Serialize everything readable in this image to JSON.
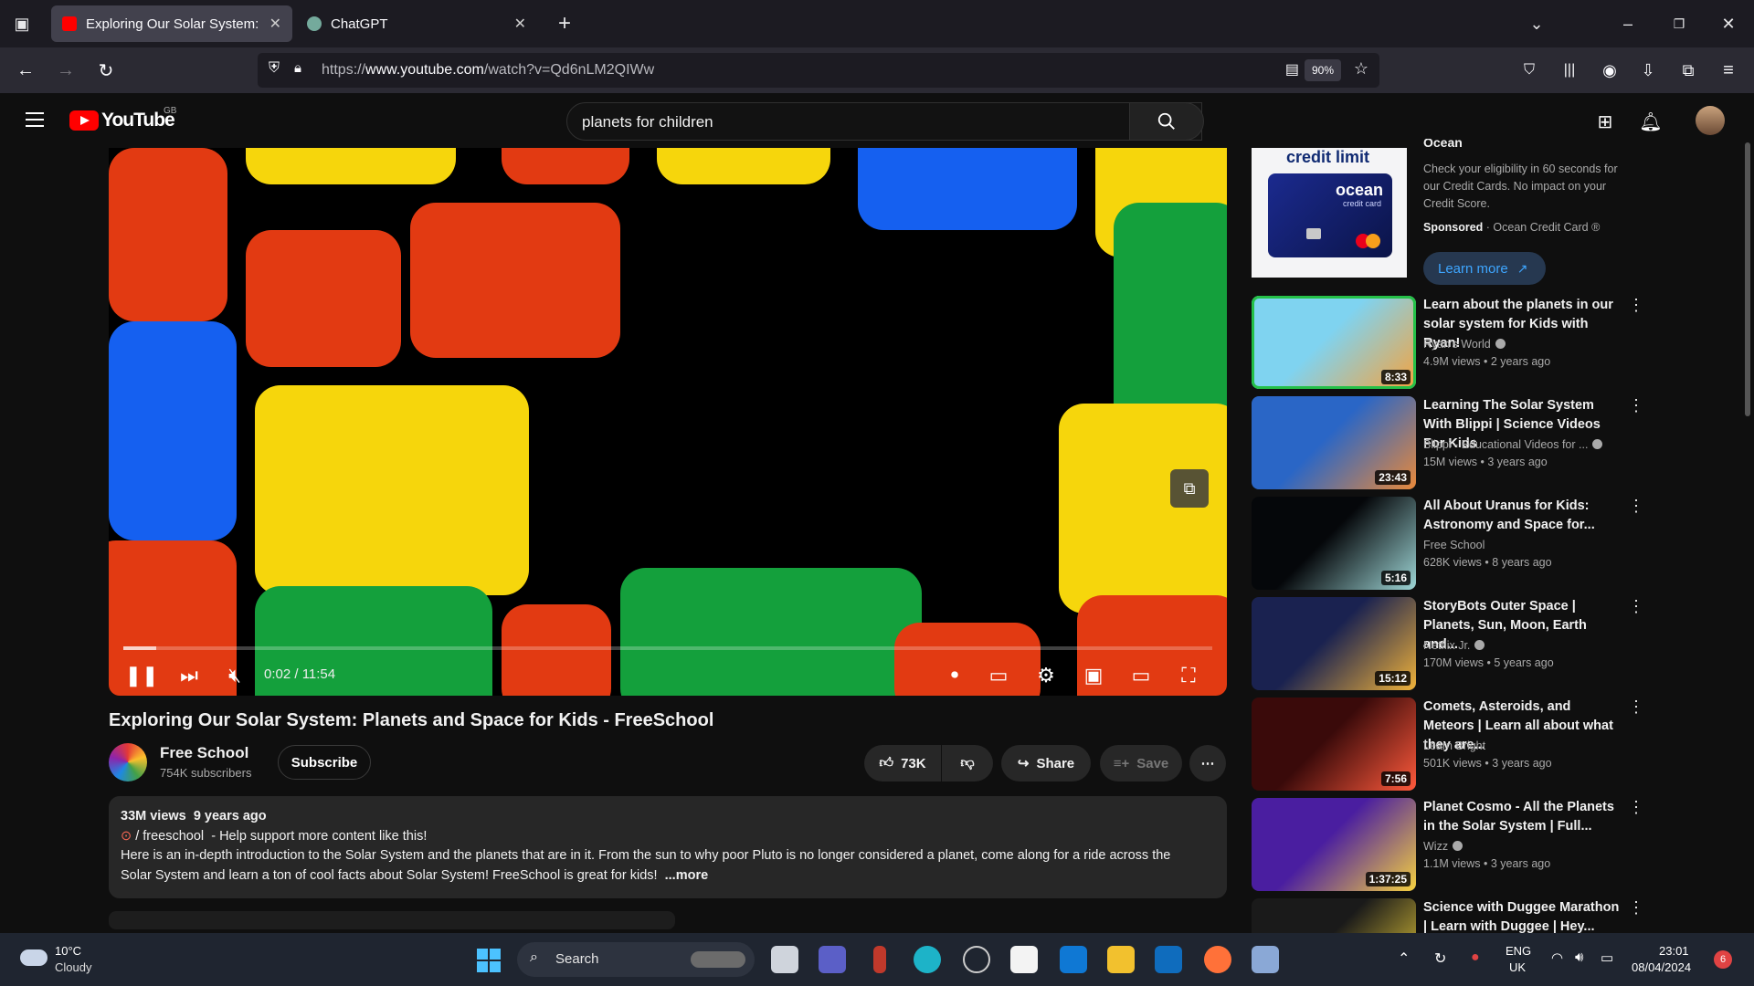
{
  "browser": {
    "tabs": [
      {
        "title": "Exploring Our Solar System: Pla",
        "active": true
      },
      {
        "title": "ChatGPT",
        "active": false
      }
    ],
    "url_prefix": "https://",
    "url_host": "www.youtube.com",
    "url_path": "/watch?v=Qd6nLM2QIWw",
    "zoom": "90%"
  },
  "youtube": {
    "logo_text": "YouTube",
    "country": "GB",
    "search_query": "planets for children"
  },
  "player": {
    "time": "0:02 / 11:54",
    "progress": 0.003
  },
  "video": {
    "title": "Exploring Our Solar System: Planets and Space for Kids - FreeSchool",
    "channel": "Free School",
    "subscribers": "754K subscribers",
    "subscribe_label": "Subscribe",
    "likes": "73K",
    "share_label": "Share",
    "save_label": "Save",
    "views": "33M views",
    "age": "9 years ago",
    "desc_line1_tag": "/ freeschool",
    "desc_line1_rest": "- Help support more content like this!",
    "desc_line2": "Here is an in-depth introduction to the Solar System and the planets that are in it. From the sun to why poor Pluto is no longer considered a planet, come along for a ride across the",
    "desc_line3": "Solar System and learn a ton of cool facts about Solar System! FreeSchool is great for kids!",
    "more_label": "...more"
  },
  "ad": {
    "card_title": "credit limit",
    "card_brand": "ocean",
    "card_sub": "credit card",
    "heading_fragment": "Ocean",
    "text": "Check your eligibility in 60 seconds for our Credit Cards. No impact on your Credit Score.",
    "sponsored": "Sponsored",
    "advertiser": "· Ocean Credit Card ®",
    "cta": "Learn more"
  },
  "recommendations": [
    {
      "title": "Learn about the planets in our solar system for Kids with Ryan!",
      "channel": "Ryan's World",
      "verified": true,
      "views": "4.9M views",
      "age": "2 years ago",
      "duration": "8:33",
      "colors": [
        "#7fd3f0",
        "#f6a23c"
      ]
    },
    {
      "title": "Learning The Solar System With Blippi | Science Videos For Kids",
      "channel": "Blippi - Educational Videos for ...",
      "verified": true,
      "views": "15M views",
      "age": "3 years ago",
      "duration": "23:43",
      "colors": [
        "#2a66c6",
        "#e9893a"
      ]
    },
    {
      "title": "All About Uranus for Kids: Astronomy and Space for...",
      "channel": "Free School",
      "verified": false,
      "views": "628K views",
      "age": "8 years ago",
      "duration": "5:16",
      "colors": [
        "#05070a",
        "#9ed6d6"
      ]
    },
    {
      "title": "StoryBots Outer Space | Planets, Sun, Moon, Earth and...",
      "channel": "Netflix Jr.",
      "verified": true,
      "views": "170M views",
      "age": "5 years ago",
      "duration": "15:12",
      "colors": [
        "#1a2250",
        "#f0b23a"
      ]
    },
    {
      "title": "Comets, Asteroids, and Meteors | Learn all about what they are...",
      "channel": "Learn Bright",
      "verified": false,
      "views": "501K views",
      "age": "3 years ago",
      "duration": "7:56",
      "colors": [
        "#3a0a0a",
        "#ff5a3c"
      ]
    },
    {
      "title": "Planet Cosmo - All the Planets in the Solar System | Full...",
      "channel": "Wizz",
      "verified": true,
      "views": "1.1M views",
      "age": "3 years ago",
      "duration": "1:37:25",
      "colors": [
        "#4a1ea0",
        "#f6d140"
      ]
    },
    {
      "title": "Science with Duggee Marathon | Learn with Duggee | Hey...",
      "channel": "",
      "verified": false,
      "views": "",
      "age": "",
      "duration": "",
      "colors": [
        "#1a1a1a",
        "#f2d43a"
      ]
    }
  ],
  "taskbar": {
    "temperature": "10°C",
    "weather": "Cloudy",
    "search_label": "Search",
    "lang1": "ENG",
    "lang2": "UK",
    "time": "23:01",
    "date": "08/04/2024",
    "notifications": "6"
  }
}
